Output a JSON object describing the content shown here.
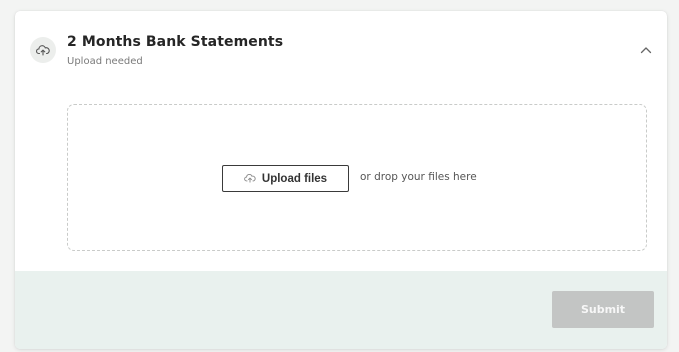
{
  "section": {
    "title": "2 Months Bank Statements",
    "status": "Upload needed",
    "header_icon": "cloud-upload-icon",
    "toggle_icon": "chevron-up-icon"
  },
  "dropzone": {
    "upload_button_label": "Upload files",
    "upload_button_icon": "cloud-upload-icon",
    "hint": "or drop your files here"
  },
  "footer": {
    "submit_label": "Submit",
    "submit_disabled": true
  },
  "colors": {
    "footer_background": "#e9f1ee",
    "submit_disabled": "#c3c5c4",
    "dropzone_border": "#c9cbc9"
  }
}
